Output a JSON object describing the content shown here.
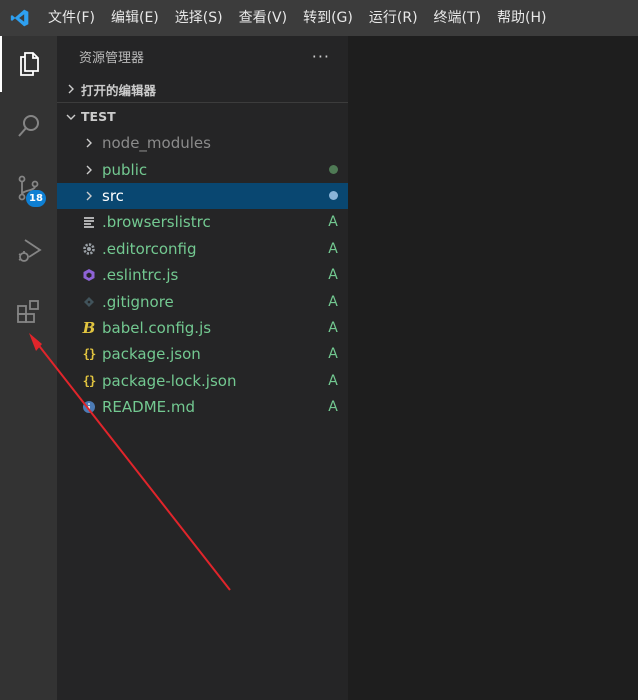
{
  "menu": [
    "文件(F)",
    "编辑(E)",
    "选择(S)",
    "查看(V)",
    "转到(G)",
    "运行(R)",
    "终端(T)",
    "帮助(H)"
  ],
  "activity": {
    "scm_badge": "18"
  },
  "sidebar": {
    "title": "资源管理器",
    "more": "···",
    "open_editors": "打开的编辑器",
    "workspace": "TEST"
  },
  "files": [
    {
      "name": "node_modules",
      "icon": "folder-chevron",
      "status": "",
      "color": "#8b8b8b"
    },
    {
      "name": "public",
      "icon": "folder-chevron",
      "status": "dot",
      "color": "#73c991"
    },
    {
      "name": "src",
      "icon": "folder-chevron",
      "status": "dot",
      "color": "#ffffff",
      "selected": true
    },
    {
      "name": ".browserslistrc",
      "icon": "list-icon",
      "status": "A",
      "color": "#73c991"
    },
    {
      "name": ".editorconfig",
      "icon": "gear-icon",
      "status": "A",
      "color": "#73c991"
    },
    {
      "name": ".eslintrc.js",
      "icon": "eslint-icon",
      "status": "A",
      "color": "#73c991"
    },
    {
      "name": ".gitignore",
      "icon": "git-icon",
      "status": "A",
      "color": "#73c991"
    },
    {
      "name": "babel.config.js",
      "icon": "babel-icon",
      "status": "A",
      "color": "#73c991"
    },
    {
      "name": "package.json",
      "icon": "json-braces-icon",
      "status": "A",
      "color": "#73c991"
    },
    {
      "name": "package-lock.json",
      "icon": "json-braces-icon",
      "status": "A",
      "color": "#73c991"
    },
    {
      "name": "README.md",
      "icon": "info-icon",
      "status": "A",
      "color": "#73c991"
    }
  ],
  "colors": {
    "accent": "#0e7fd3",
    "selection": "#094771",
    "added": "#73c991",
    "annotation_arrow": "#e0252b"
  }
}
